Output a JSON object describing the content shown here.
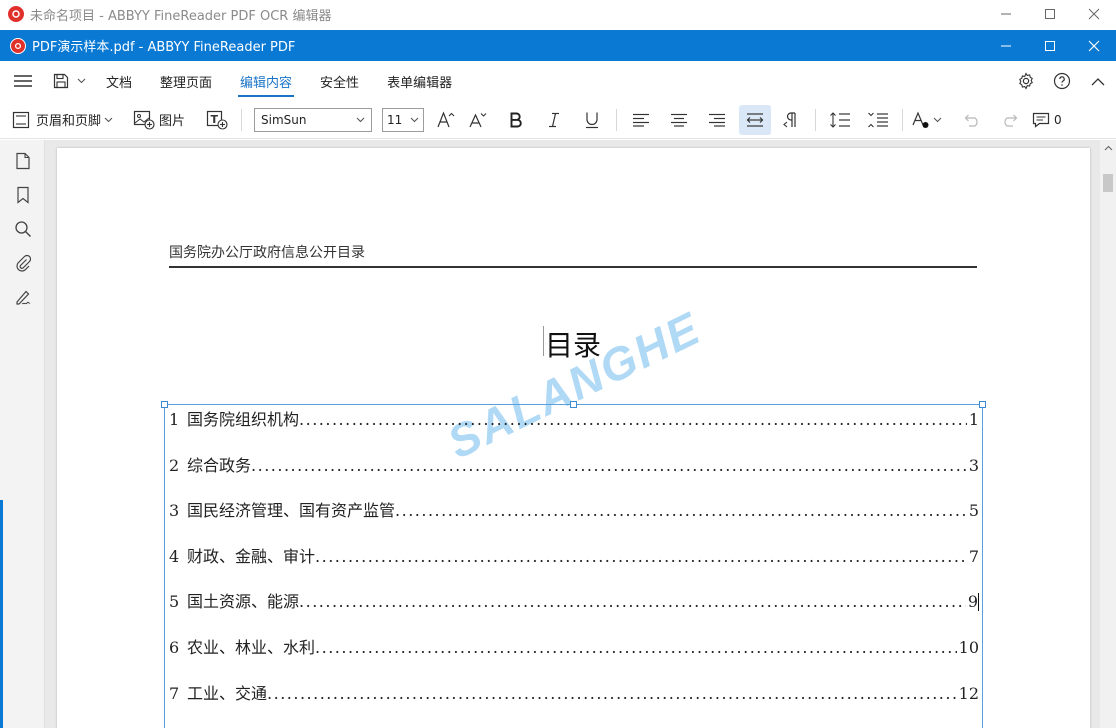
{
  "outer_window": {
    "title": "未命名项目 - ABBYY FineReader PDF OCR 编辑器"
  },
  "inner_window": {
    "title": "PDF演示样本.pdf - ABBYY FineReader PDF"
  },
  "menu": {
    "tabs": [
      {
        "label": "文档",
        "active": false
      },
      {
        "label": "整理页面",
        "active": false
      },
      {
        "label": "编辑内容",
        "active": true
      },
      {
        "label": "安全性",
        "active": false
      },
      {
        "label": "表单编辑器",
        "active": false
      }
    ]
  },
  "toolbar": {
    "header_footer": "页眉和页脚",
    "image": "图片",
    "font_name": "SimSun",
    "font_size": "11",
    "comments_count": "0"
  },
  "document": {
    "header": "国务院办公厅政府信息公开目录",
    "title": "目录",
    "watermark": "SALANGHE",
    "toc": [
      {
        "num": "1",
        "text": "国务院组织机构",
        "page": "1"
      },
      {
        "num": "2",
        "text": "综合政务",
        "page": "3"
      },
      {
        "num": "3",
        "text": "国民经济管理、国有资产监管",
        "page": "5"
      },
      {
        "num": "4",
        "text": "财政、金融、审计",
        "page": "7"
      },
      {
        "num": "5",
        "text": "国土资源、能源",
        "page": "9"
      },
      {
        "num": "6",
        "text": "农业、林业、水利",
        "page": "10"
      },
      {
        "num": "7",
        "text": "工业、交通",
        "page": "12"
      }
    ]
  },
  "colors": {
    "accent": "#0a79d4",
    "active_tab": "#1a73c7",
    "watermark": "#50aaeb"
  }
}
